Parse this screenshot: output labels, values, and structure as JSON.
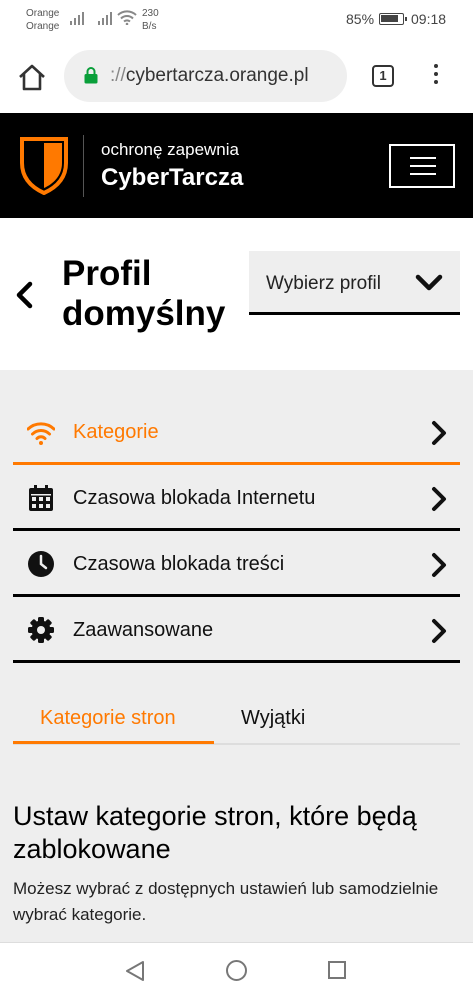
{
  "status_bar": {
    "carrier1": "Orange",
    "carrier2": "Orange",
    "speed_value": "230",
    "speed_unit": "B/s",
    "battery": "85%",
    "time": "09:18",
    "icons": [
      "signal-icon",
      "signal-icon",
      "wifi-icon",
      "battery-icon"
    ]
  },
  "browser": {
    "url_scheme": "://",
    "url_host": "cybertarcza.orange.pl",
    "tab_count": "1",
    "icons": [
      "home-icon",
      "lock-icon",
      "tabs-icon",
      "overflow-menu-icon"
    ]
  },
  "site_header": {
    "tagline": "ochronę zapewnia",
    "brand": "CyberTarcza",
    "logo_icon": "shield-icon",
    "menu_icon": "hamburger-icon"
  },
  "profile": {
    "title": "Profil domyślny",
    "select_label": "Wybierz profil"
  },
  "menu": {
    "items": [
      {
        "label": "Kategorie",
        "icon": "wifi-icon",
        "active": true
      },
      {
        "label": "Czasowa blokada Internetu",
        "icon": "calendar-icon",
        "active": false
      },
      {
        "label": "Czasowa blokada treści",
        "icon": "clock-icon",
        "active": false
      },
      {
        "label": "Zaawansowane",
        "icon": "gear-icon",
        "active": false
      }
    ]
  },
  "subtabs": {
    "items": [
      {
        "label": "Kategorie stron",
        "active": true
      },
      {
        "label": "Wyjątki",
        "active": false
      }
    ]
  },
  "content": {
    "heading": "Ustaw kategorie stron, które będą zablokowane",
    "description": "Możesz wybrać z dostępnych ustawień lub samodzielnie wybrać kategorie."
  },
  "colors": {
    "accent": "#ff7900",
    "header_bg": "#000000",
    "panel_bg": "#eeeeee"
  }
}
